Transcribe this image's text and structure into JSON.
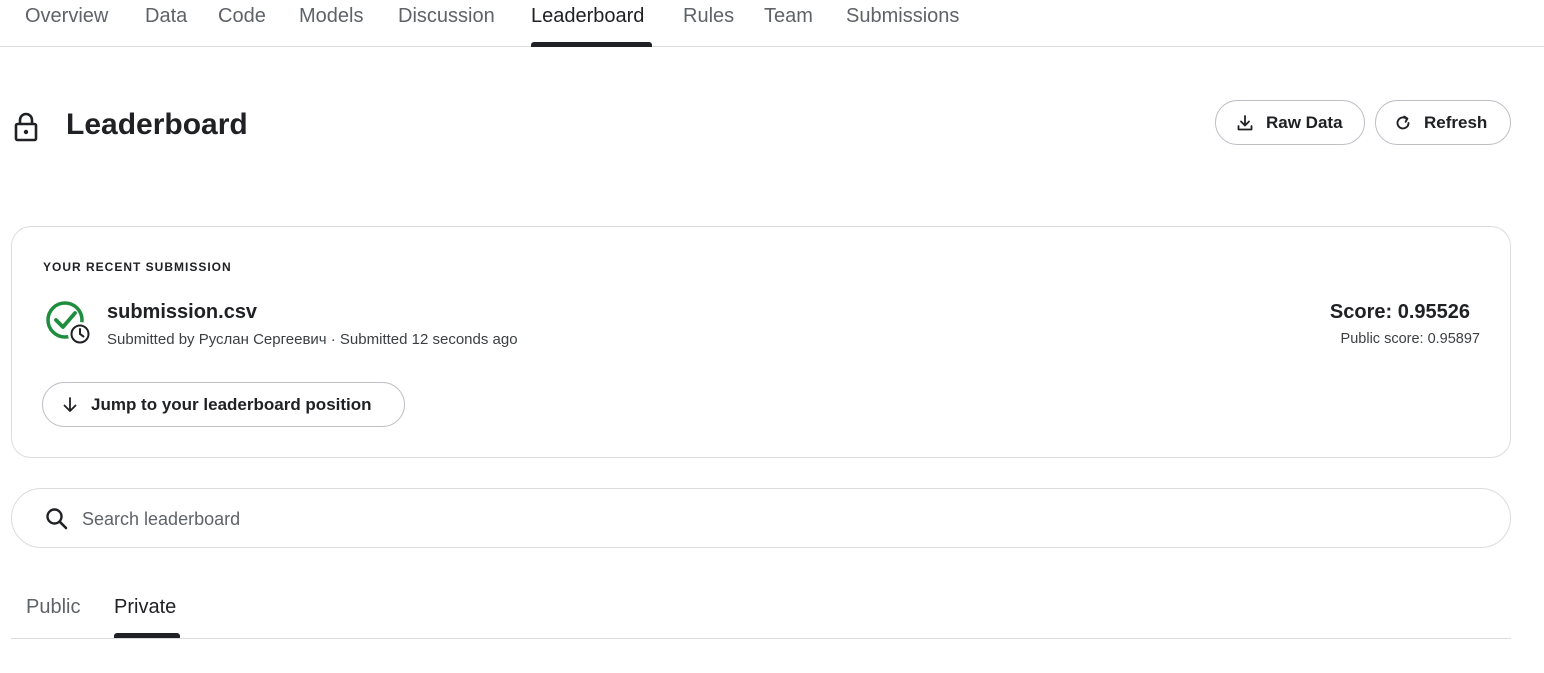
{
  "nav": {
    "tabs": [
      {
        "label": "Overview"
      },
      {
        "label": "Data"
      },
      {
        "label": "Code"
      },
      {
        "label": "Models"
      },
      {
        "label": "Discussion"
      },
      {
        "label": "Leaderboard",
        "active": true
      },
      {
        "label": "Rules"
      },
      {
        "label": "Team"
      },
      {
        "label": "Submissions"
      }
    ]
  },
  "header": {
    "title": "Leaderboard",
    "icon": "lock-icon",
    "raw_data_label": "Raw Data",
    "refresh_label": "Refresh"
  },
  "recent_submission": {
    "section_label": "YOUR RECENT SUBMISSION",
    "status_icon": "check-clock-icon",
    "file_name": "submission.csv",
    "submitted_by": "Submitted by Руслан Сергеевич · Submitted 12 seconds ago",
    "score": "Score: 0.95526",
    "public_score": "Public score: 0.95897",
    "jump_label": "Jump to your leaderboard position"
  },
  "search": {
    "placeholder": "Search leaderboard"
  },
  "subtabs": [
    {
      "label": "Public"
    },
    {
      "label": "Private",
      "active": true
    }
  ],
  "colors": {
    "accent": "#202124",
    "success": "#1e8e3e",
    "border": "#dadce0"
  }
}
